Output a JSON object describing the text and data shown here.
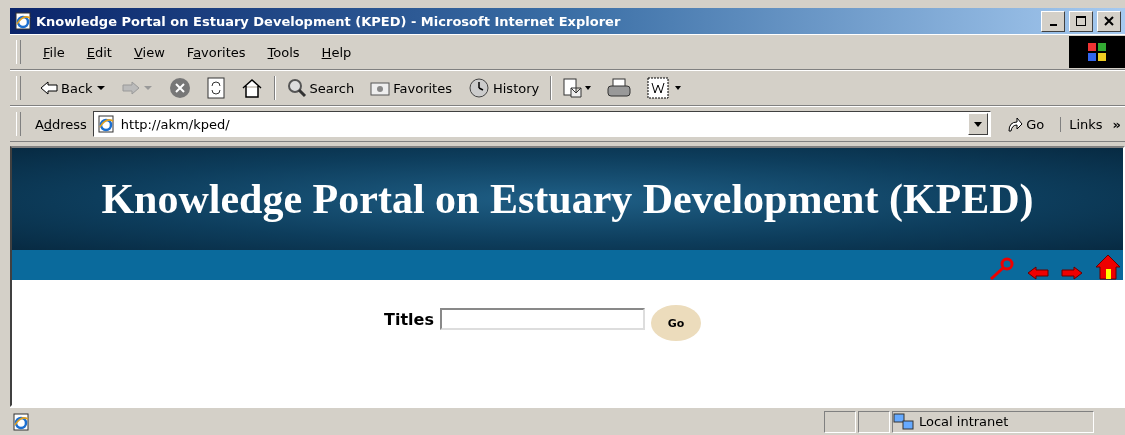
{
  "window": {
    "title": "Knowledge Portal on Estuary Development (KPED) - Microsoft Internet Explorer"
  },
  "menu": [
    {
      "key": "F",
      "rest": "ile"
    },
    {
      "key": "E",
      "rest": "dit"
    },
    {
      "key": "V",
      "rest": "iew"
    },
    {
      "pre": "F",
      "key": "a",
      "rest": "vorites"
    },
    {
      "key": "T",
      "rest": "ools"
    },
    {
      "key": "H",
      "rest": "elp"
    }
  ],
  "toolbar": [
    {
      "kind": "back",
      "label": "Back",
      "disabled": false
    },
    {
      "kind": "forward",
      "disabled": true
    },
    {
      "kind": "stop"
    },
    {
      "kind": "refresh"
    },
    {
      "kind": "home"
    },
    {
      "kind": "sep"
    },
    {
      "kind": "search",
      "label": "Search"
    },
    {
      "kind": "favorites",
      "label": "Favorites"
    },
    {
      "kind": "history",
      "label": "History"
    },
    {
      "kind": "sep"
    },
    {
      "kind": "mail"
    },
    {
      "kind": "print"
    },
    {
      "kind": "edit"
    }
  ],
  "address": {
    "label_pre": "A",
    "label_key": "d",
    "label_rest": "dress",
    "value": "http://akm/kped/",
    "go": "Go",
    "links": "Links",
    "more": "»"
  },
  "page": {
    "banner": "Knowledge Portal on Estuary Development (KPED)",
    "search_label": "Titles",
    "go": "Go"
  },
  "status_bar": {
    "zone": "Local intranet"
  }
}
